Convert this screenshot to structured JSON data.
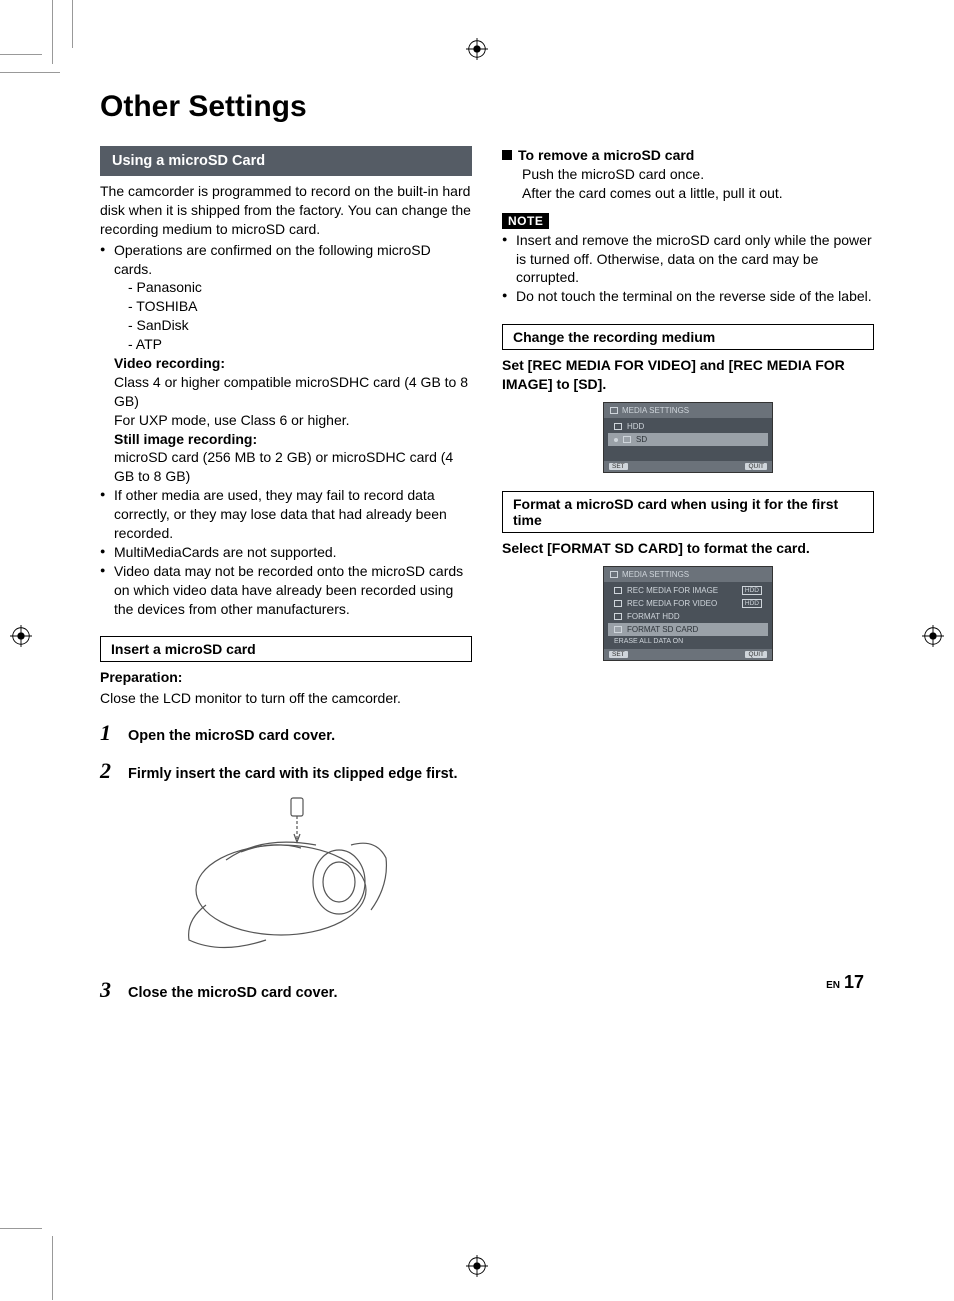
{
  "page": {
    "title": "Other Settings",
    "footer_lang": "EN",
    "footer_page": "17"
  },
  "left": {
    "heading_bar": "Using a microSD Card",
    "intro": "The camcorder is programmed to record on the built-in hard disk when it is shipped from the factory. You can change the recording medium to microSD card.",
    "bullet1": "Operations are confirmed on the following microSD cards.",
    "brands": [
      "- Panasonic",
      "- TOSHIBA",
      "- SanDisk",
      "- ATP"
    ],
    "vid_label": "Video recording:",
    "vid_line1": "Class 4 or higher compatible microSDHC card (4 GB to 8 GB)",
    "vid_line2": "For UXP mode, use Class 6 or higher.",
    "still_label": "Still image recording:",
    "still_line": "microSD card (256 MB to 2 GB) or microSDHC card (4 GB to 8 GB)",
    "bullet2": "If other media are used, they may fail to record data correctly, or they may lose data that had already been recorded.",
    "bullet3": "MultiMediaCards are not supported.",
    "bullet4": "Video data may not be recorded onto the microSD cards on which video data have already been recorded using the devices from other manufacturers.",
    "insert_box": "Insert a microSD card",
    "prep_label": "Preparation:",
    "prep_text": "Close the LCD monitor to turn off the camcorder.",
    "step1": "Open the microSD card cover.",
    "step2": "Firmly insert the card with its clipped edge first.",
    "step3": "Close the microSD card cover."
  },
  "right": {
    "remove_heading": "To remove a microSD card",
    "remove_l1": "Push the microSD card once.",
    "remove_l2": "After the card comes out a little, pull it out.",
    "note_label": "NOTE",
    "note1": "Insert and remove the microSD card only while the power is turned off. Otherwise, data on the card may be corrupted.",
    "note2": "Do not touch the terminal on the reverse side of the label.",
    "change_box": "Change the recording medium",
    "change_instr": "Set [REC MEDIA FOR VIDEO] and [REC MEDIA FOR IMAGE] to [SD].",
    "screen1": {
      "title": "MEDIA SETTINGS",
      "row1": "HDD",
      "row2": "SD",
      "set": "SET",
      "quit": "QUIT"
    },
    "format_box": "Format a microSD card when using it for the first time",
    "format_instr": "Select [FORMAT SD CARD] to format the card.",
    "screen2": {
      "title": "MEDIA SETTINGS",
      "r1": "REC MEDIA FOR IMAGE",
      "r2": "REC MEDIA FOR VIDEO",
      "r3": "FORMAT HDD",
      "r4": "FORMAT SD CARD",
      "r5": "ERASE ALL DATA ON",
      "set": "SET",
      "quit": "QUIT",
      "badge": "HDD"
    }
  }
}
